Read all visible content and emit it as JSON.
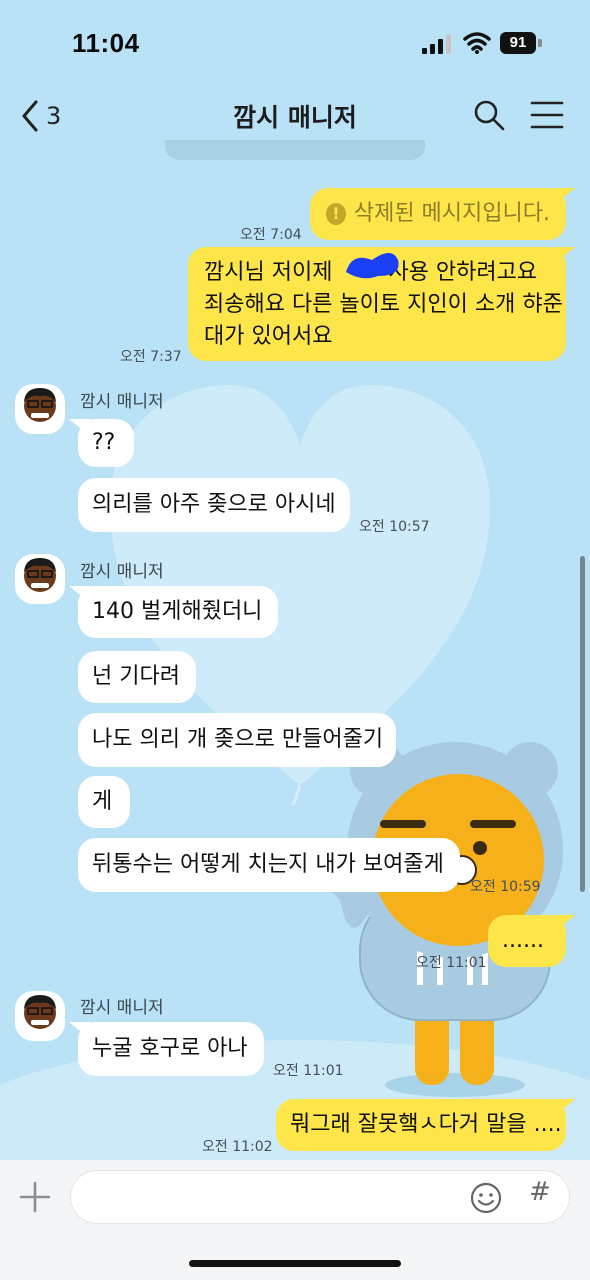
{
  "status": {
    "time": "11:04",
    "battery": "91"
  },
  "header": {
    "back_count": "3",
    "title": "깜시 매니저"
  },
  "messages": {
    "m1": {
      "text": "삭제된 메시지입니다.",
      "time": "오전 7:04"
    },
    "m2": {
      "line1": "깜시님  저이제",
      "line1b": "사용  안하려고요",
      "line2": "죄송해요 다른 놀이토 지인이 소개 햐준",
      "line3": "대가 있어서요",
      "time": "오전 7:37"
    },
    "g1": {
      "sender": "깜시 매니저",
      "b1": "??",
      "b2": "의리를 아주 좆으로 아시네",
      "time": "오전 10:57"
    },
    "g2": {
      "sender": "깜시 매니저",
      "b1": "140 벌게해줬더니",
      "b2": "넌 기다려",
      "b3": "나도 의리 개 좆으로 만들어줄기",
      "b4": "게",
      "b5": "뒤통수는 어떻게 치는지 내가 보여줄게",
      "time": "오전 10:59"
    },
    "m3": {
      "text": "......",
      "time": "오전 11:01"
    },
    "g3": {
      "sender": "깜시 매니저",
      "b1": "누굴 호구로 아나",
      "time": "오전 11:01"
    },
    "m4": {
      "text": "뭐그래 잘못햌ㅅ다거 말을 ....",
      "time": "오전 11:02"
    }
  },
  "colors": {
    "background": "#b9e2f6",
    "my_bubble": "#fee54a",
    "their_bubble": "#ffffff"
  },
  "input": {
    "placeholder": ""
  }
}
